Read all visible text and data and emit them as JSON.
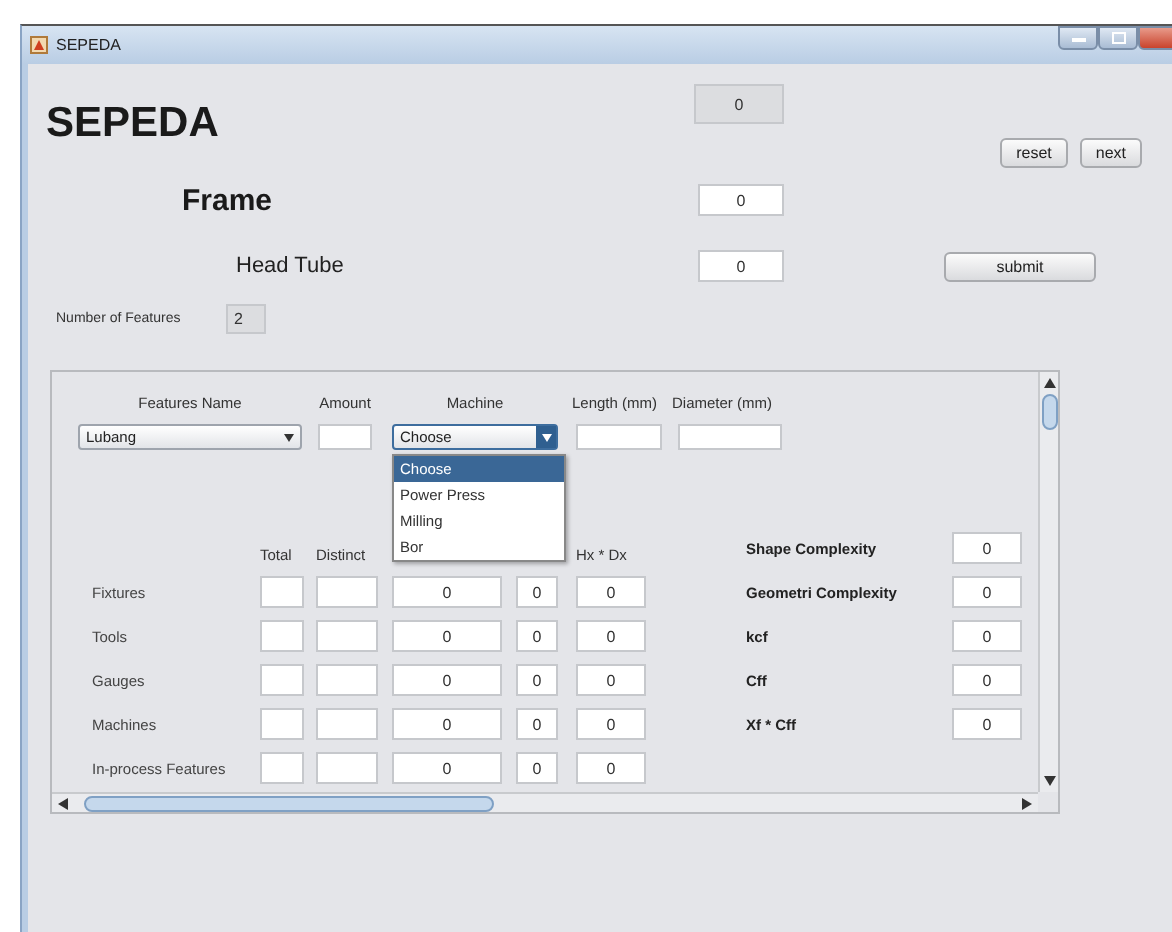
{
  "window": {
    "title": "SEPEDA"
  },
  "heading": "SEPEDA",
  "top_value": "0",
  "top_buttons": [
    {
      "label": "reset"
    },
    {
      "label": "next"
    }
  ],
  "frame": {
    "label": "Frame",
    "value": "0"
  },
  "part": {
    "label": "Head Tube",
    "value": "0"
  },
  "submit": "submit",
  "number_of_features": {
    "label": "Number of Features",
    "value": "2"
  },
  "features": {
    "columns": [
      "Features Name",
      "Amount",
      "Machine",
      "Length (mm)",
      "Diameter (mm)"
    ],
    "feature": "Lubang",
    "machine": "Choose",
    "machine_options": [
      {
        "label": "Choose",
        "selected": true
      },
      {
        "label": "Power Press",
        "selected": false
      },
      {
        "label": "Milling",
        "selected": false
      },
      {
        "label": "Bor",
        "selected": false
      }
    ]
  },
  "resources": {
    "columns": [
      "Total",
      "Distinct"
    ],
    "last_column": "Hx * Dx",
    "rows": [
      {
        "label": "Fixtures",
        "values": [
          "0",
          "0",
          "0"
        ]
      },
      {
        "label": "Tools",
        "values": [
          "0",
          "0",
          "0"
        ]
      },
      {
        "label": "Gauges",
        "values": [
          "0",
          "0",
          "0"
        ]
      },
      {
        "label": "Machines",
        "values": [
          "0",
          "0",
          "0"
        ]
      },
      {
        "label": "In-process Features",
        "values": [
          "0",
          "0",
          "0"
        ]
      }
    ]
  },
  "complexity": [
    {
      "label": "Shape Complexity",
      "value": "0"
    },
    {
      "label": "Geometri Complexity",
      "value": "0"
    },
    {
      "label": "kcf",
      "value": "0"
    },
    {
      "label": "Cff",
      "value": "0"
    },
    {
      "label": "Xf * Cff",
      "value": "0"
    }
  ]
}
